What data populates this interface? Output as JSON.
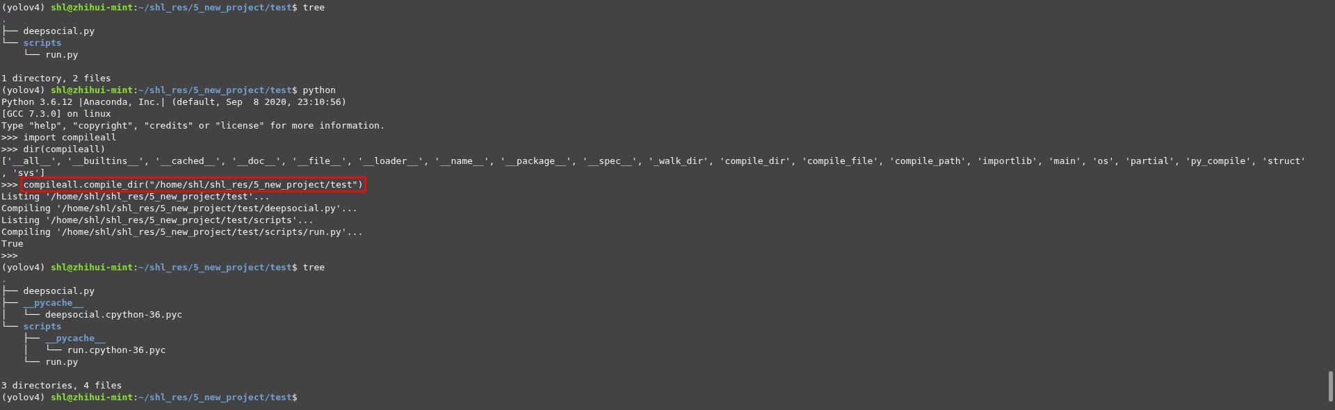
{
  "terminal": {
    "lines": [
      {
        "kind": "prompt",
        "env": "(yolov4) ",
        "user_host": "shl@zhihui-mint",
        "separator": ":",
        "path": "~/shl_res/5_new_project/test",
        "symbol": "$ ",
        "command": "tree"
      },
      {
        "kind": "tree",
        "name": ".",
        "directory": true
      },
      {
        "kind": "tree",
        "prefix": "├── ",
        "name": "deepsocial.py",
        "directory": false
      },
      {
        "kind": "tree",
        "prefix": "└── ",
        "name": "scripts",
        "directory": true
      },
      {
        "kind": "tree",
        "prefix": "    └── ",
        "name": "run.py",
        "directory": false
      },
      {
        "kind": "blank"
      },
      {
        "kind": "output",
        "text": "1 directory, 2 files"
      },
      {
        "kind": "prompt",
        "env": "(yolov4) ",
        "user_host": "shl@zhihui-mint",
        "separator": ":",
        "path": "~/shl_res/5_new_project/test",
        "symbol": "$ ",
        "command": "python"
      },
      {
        "kind": "output",
        "text": "Python 3.6.12 |Anaconda, Inc.| (default, Sep  8 2020, 23:10:56)"
      },
      {
        "kind": "output",
        "text": "[GCC 7.3.0] on linux"
      },
      {
        "kind": "output",
        "text": "Type \"help\", \"copyright\", \"credits\" or \"license\" for more information."
      },
      {
        "kind": "input",
        "prompt": ">>> ",
        "text": "import compileall"
      },
      {
        "kind": "input",
        "prompt": ">>> ",
        "text": "dir(compileall)"
      },
      {
        "kind": "output",
        "text": "['__all__', '__builtins__', '__cached__', '__doc__', '__file__', '__loader__', '__name__', '__package__', '__spec__', '_walk_dir', 'compile_dir', 'compile_file', 'compile_path', 'importlib', 'main', 'os', 'partial', 'py_compile', 'struct'"
      },
      {
        "kind": "output",
        "text": ", 'sys']"
      },
      {
        "kind": "input",
        "prompt": ">>> ",
        "text": "compileall.compile_dir(\"/home/shl/shl_res/5_new_project/test\")",
        "highlighted": true
      },
      {
        "kind": "output",
        "text": "Listing '/home/shl/shl_res/5_new_project/test'..."
      },
      {
        "kind": "output",
        "text": "Compiling '/home/shl/shl_res/5_new_project/test/deepsocial.py'..."
      },
      {
        "kind": "output",
        "text": "Listing '/home/shl/shl_res/5_new_project/test/scripts'..."
      },
      {
        "kind": "output",
        "text": "Compiling '/home/shl/shl_res/5_new_project/test/scripts/run.py'..."
      },
      {
        "kind": "output",
        "text": "True"
      },
      {
        "kind": "input",
        "prompt": ">>>"
      },
      {
        "kind": "prompt",
        "env": "(yolov4) ",
        "user_host": "shl@zhihui-mint",
        "separator": ":",
        "path": "~/shl_res/5_new_project/test",
        "symbol": "$ ",
        "command": "tree"
      },
      {
        "kind": "tree",
        "name": ".",
        "directory": true
      },
      {
        "kind": "tree",
        "prefix": "├── ",
        "name": "deepsocial.py",
        "directory": false
      },
      {
        "kind": "tree",
        "prefix": "├── ",
        "name": "__pycache__",
        "directory": true
      },
      {
        "kind": "tree",
        "prefix": "│   └── ",
        "name": "deepsocial.cpython-36.pyc",
        "directory": false
      },
      {
        "kind": "tree",
        "prefix": "└── ",
        "name": "scripts",
        "directory": true
      },
      {
        "kind": "tree",
        "prefix": "    ├── ",
        "name": "__pycache__",
        "directory": true
      },
      {
        "kind": "tree",
        "prefix": "    │   └── ",
        "name": "run.cpython-36.pyc",
        "directory": false
      },
      {
        "kind": "tree",
        "prefix": "    └── ",
        "name": "run.py",
        "directory": false
      },
      {
        "kind": "blank"
      },
      {
        "kind": "output",
        "text": "3 directories, 4 files"
      },
      {
        "kind": "prompt",
        "env": "(yolov4) ",
        "user_host": "shl@zhihui-mint",
        "separator": ":",
        "path": "~/shl_res/5_new_project/test",
        "symbol": "$"
      }
    ]
  }
}
